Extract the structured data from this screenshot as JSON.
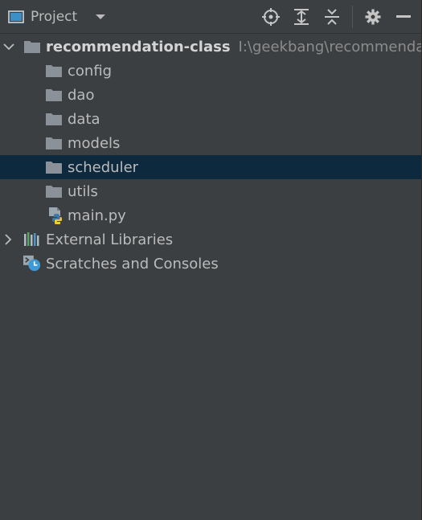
{
  "header": {
    "title": "Project"
  },
  "tree": {
    "root": {
      "name": "recommendation-class",
      "path": "I:\\geekbang\\recommendation"
    },
    "children": [
      {
        "label": "config"
      },
      {
        "label": "dao"
      },
      {
        "label": "data"
      },
      {
        "label": "models"
      },
      {
        "label": "scheduler"
      },
      {
        "label": "utils"
      },
      {
        "label": "main.py"
      }
    ],
    "external_libraries": "External Libraries",
    "scratches": "Scratches and Consoles"
  },
  "colors": {
    "background": "#3c3f41",
    "selection": "#0d293e",
    "folder": "#8a9198",
    "text": "#bbbbbb",
    "path": "#8c8c8c"
  }
}
